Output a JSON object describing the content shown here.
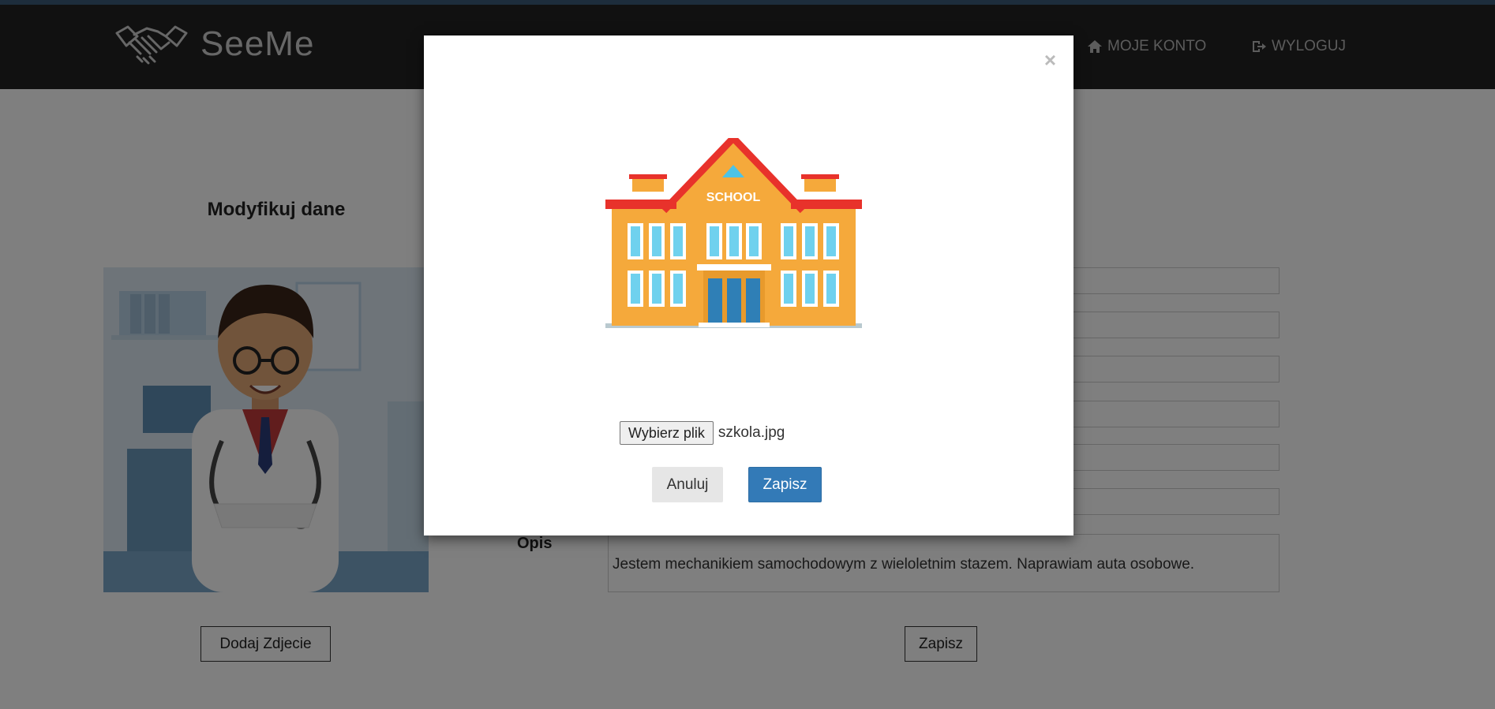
{
  "brand": {
    "name": "SeeMe",
    "icon": "handshake-icon"
  },
  "nav": {
    "account": {
      "label": "MOJE KONTO",
      "icon": "home-icon"
    },
    "logout": {
      "label": "WYLOGUJ",
      "icon": "logout-icon"
    }
  },
  "page": {
    "title": "Modyfikuj dane",
    "photo_alt": "doctor-illustration",
    "add_photo_label": "Dodaj Zdjecie",
    "save_label": "Zapisz"
  },
  "form": {
    "description_label": "Opis",
    "description_value": "Jestem mechanikiem samochodowym z wieloletnim stazem. Naprawiam auta osobowe."
  },
  "modal": {
    "close_symbol": "×",
    "preview_text": "SCHOOL",
    "file_button_label": "Wybierz plik",
    "file_name": "szkola.jpg",
    "cancel_label": "Anuluj",
    "save_label": "Zapisz"
  },
  "colors": {
    "navbar": "#222222",
    "top_strip": "#3a5a78",
    "primary_button": "#337ab7",
    "overlay": "rgba(0,0,0,0.5)"
  }
}
